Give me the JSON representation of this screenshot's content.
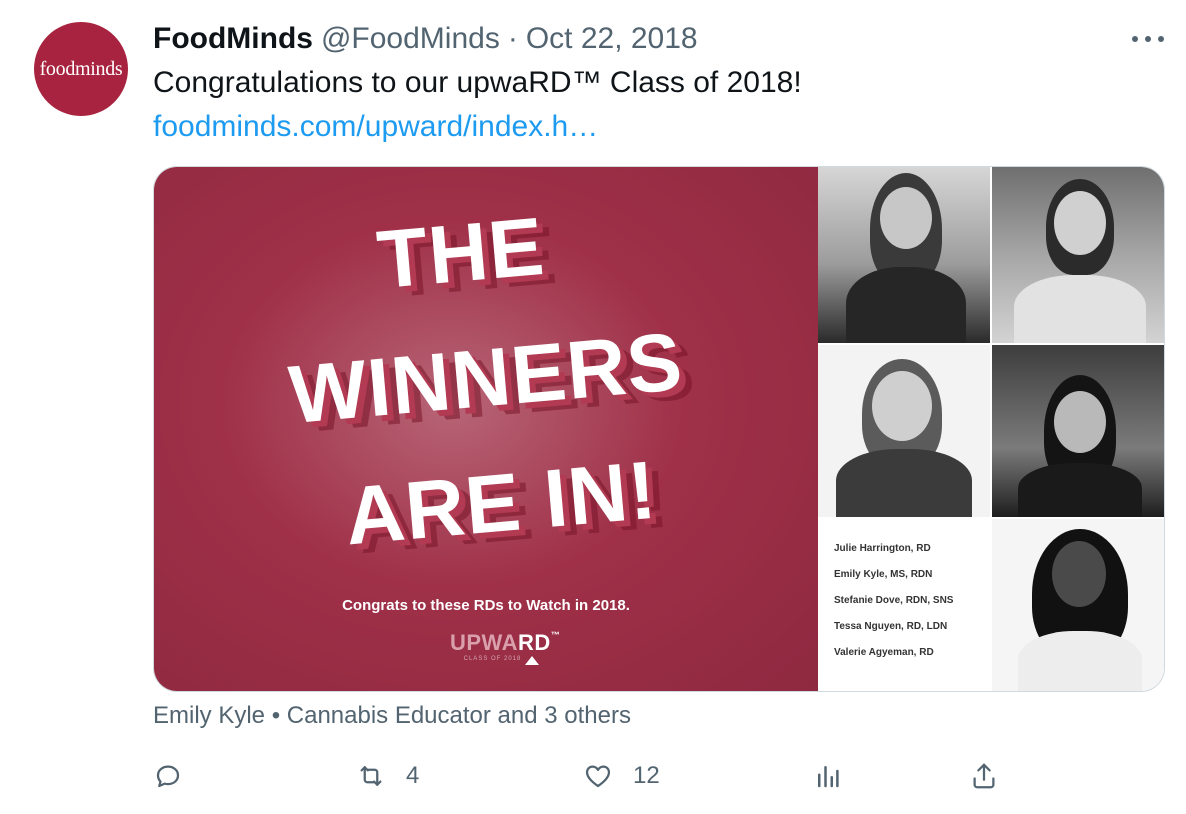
{
  "tweet": {
    "avatar_text": "foodminds",
    "name": "FoodMinds",
    "handle": "@FoodMinds",
    "separator": "·",
    "date": "Oct 22, 2018",
    "text": "Congratulations to our upwaRD™  Class of 2018!",
    "link": "foodminds.com/upward/index.h…",
    "social_context": "Emily Kyle • Cannabis Educator and 3 others"
  },
  "media": {
    "headline_lines": [
      "THE",
      "WINNERS",
      "ARE IN!"
    ],
    "congrats_line": "Congrats to these RDs to Watch in 2018.",
    "logo_light": "UPWA",
    "logo_bold": "RD",
    "logo_tm": "™",
    "logo_sub": "CLASS OF 2018",
    "winners": [
      "Julie Harrington, RD",
      "Emily Kyle, MS, RDN",
      "Stefanie Dove, RDN, SNS",
      "Tessa Nguyen, RD, LDN",
      "Valerie Agyeman, RD"
    ]
  },
  "actions": {
    "reply": {
      "icon": "reply-icon",
      "count": ""
    },
    "retweet": {
      "icon": "retweet-icon",
      "count": "4"
    },
    "like": {
      "icon": "heart-icon",
      "count": "12"
    },
    "views": {
      "icon": "analytics-icon",
      "count": ""
    },
    "share": {
      "icon": "share-icon",
      "count": ""
    }
  },
  "colors": {
    "brand": "#a8233f",
    "link": "#1d9bf0",
    "secondary_text": "#536471"
  }
}
